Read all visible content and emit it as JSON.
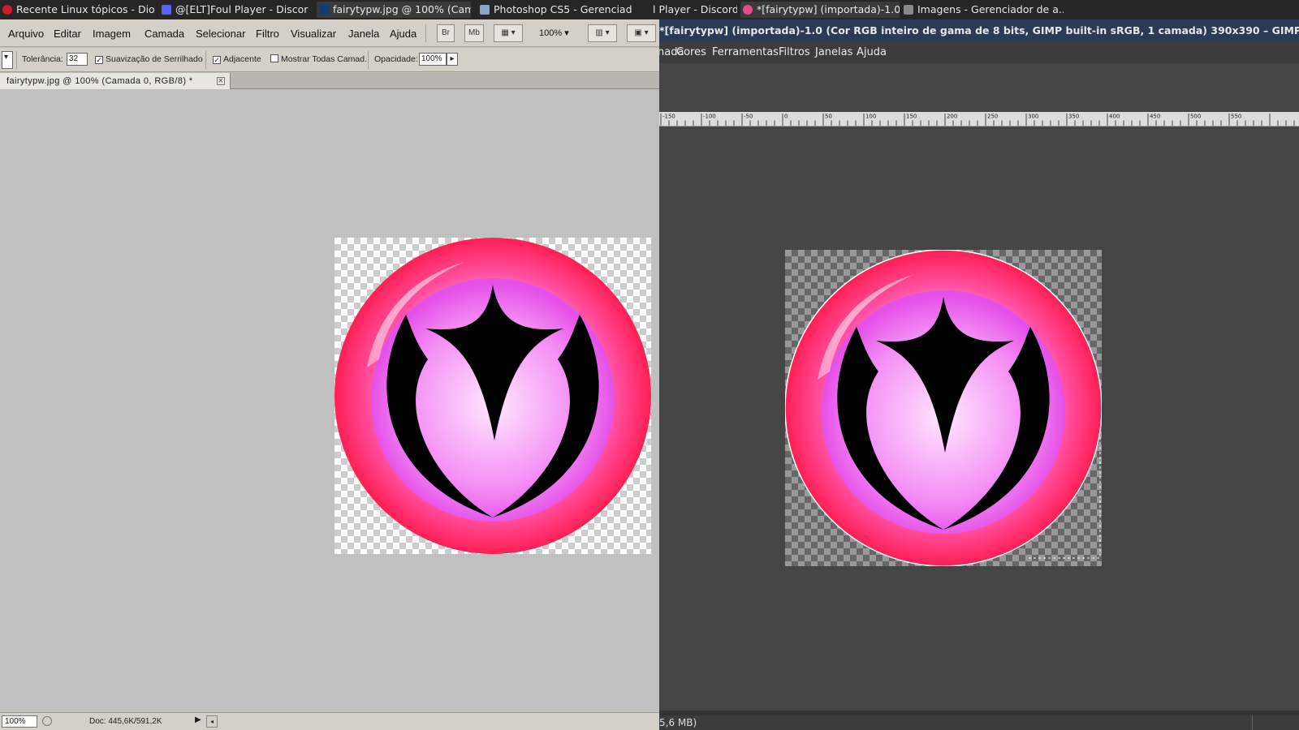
{
  "taskbar": {
    "tasks": [
      {
        "label": "Recente Linux tópicos - Dioli...",
        "icon": "opera-icon"
      },
      {
        "label": "@[ELT]Foul Player - Discord",
        "icon": "discord-icon"
      },
      {
        "label": "fairytypw.jpg @ 100% (Cam...",
        "icon": "photoshop-icon",
        "active": true
      },
      {
        "label": "Photoshop CS5 - Gerenciad...",
        "icon": "folder-icon"
      },
      {
        "label": "l Player - Discord]",
        "icon": ""
      },
      {
        "label": "*[fairytypw] (importada)-1.0...",
        "icon": "gimp-icon",
        "active": true
      },
      {
        "label": "Imagens - Gerenciador de a...",
        "icon": "image-viewer-icon"
      }
    ]
  },
  "photoshop": {
    "menu": [
      "Arquivo",
      "Editar",
      "Imagem",
      "Camada",
      "Selecionar",
      "Filtro",
      "Visualizar",
      "Janela",
      "Ajuda"
    ],
    "toolbar": {
      "bridge": "Br",
      "minibridge": "Mb",
      "zoom": "100%"
    },
    "options": {
      "tolerance_label": "Tolerância:",
      "tolerance_value": "32",
      "antialias_label": "Suavização de Serrilhado",
      "contiguous_label": "Adjacente",
      "all_layers_label": "Mostrar Todas Camad.",
      "opacity_label": "Opacidade:",
      "opacity_value": "100%"
    },
    "doc_tab": "fairytypw.jpg @ 100% (Camada 0, RGB/8) *",
    "status": {
      "zoom": "100%",
      "doc": "Doc: 445,6K/591,2K"
    }
  },
  "gimp": {
    "title": "*[fairytypw] (importada)-1.0 (Cor RGB inteiro de gama de 8 bits, GIMP built-in sRGB, 1 camada) 390x390 – GIMP",
    "menu": [
      "nada",
      "Cores",
      "Ferramentas",
      "Filtros",
      "Janelas",
      "Ajuda"
    ],
    "ruler_labels": [
      "-150",
      "-100",
      "-50",
      "0",
      "50",
      "100",
      "150",
      "200",
      "250",
      "300",
      "350",
      "400",
      "450",
      "500",
      "550"
    ],
    "status": "5,6 MB)"
  },
  "colors": {
    "ring_outer": "#ff1f55",
    "ring_mid": "#ff4fa0",
    "inner_center": "#ffd6fb",
    "inner_edge": "#e550e8",
    "symbol": "#000000"
  }
}
